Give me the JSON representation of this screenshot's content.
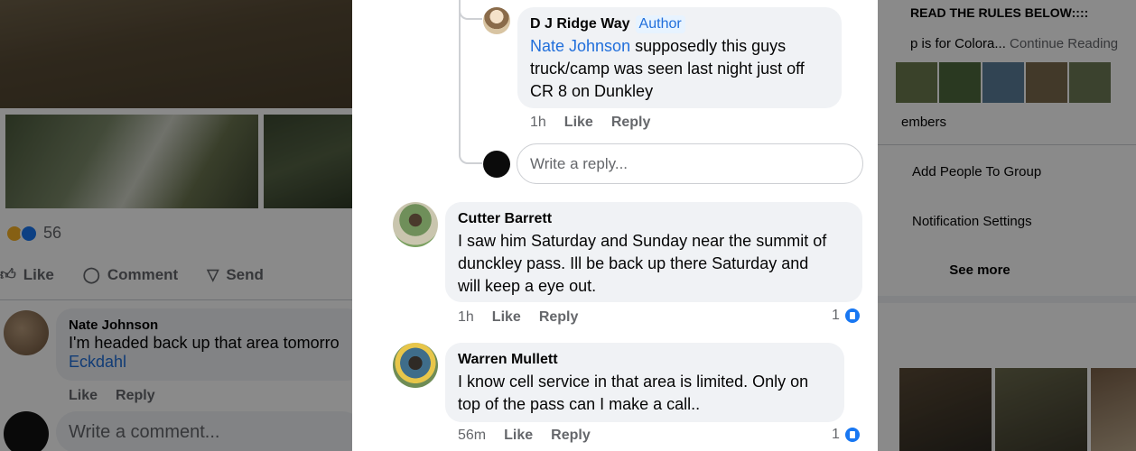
{
  "background_left": {
    "reaction_count": "56",
    "actions": {
      "like": "Like",
      "comment": "Comment",
      "send": "Send"
    },
    "comment": {
      "author": "Nate Johnson",
      "text": "I'm headed back up that area tomorro",
      "mention": "Eckdahl",
      "like": "Like",
      "reply": "Reply"
    },
    "composer_placeholder": "Write a comment..."
  },
  "background_right": {
    "rules_heading": "READ THE RULES BELOW::::",
    "about_text": "p is for Colora...",
    "continue": "Continue Reading",
    "members": "embers",
    "menu": [
      "Add People To Group",
      "Notification Settings"
    ],
    "see_more": "See more"
  },
  "thread": {
    "reply": {
      "author": "D J Ridge Way",
      "badge": "Author",
      "mention": "Nate Johnson",
      "text_line1": " supposedly this guys",
      "text_line2": "truck/camp was seen last night just off",
      "text_line3": "CR 8 on Dunkley",
      "time": "1h",
      "like": "Like",
      "reply": "Reply"
    },
    "reply_input_placeholder": "Write a reply...",
    "comments": [
      {
        "author": "Cutter Barrett",
        "lines": [
          "I saw him Saturday and Sunday near the summit of",
          "dunckley pass. Ill be back up there Saturday and",
          "will keep a eye out."
        ],
        "time": "1h",
        "like": "Like",
        "reply": "Reply",
        "likes": "1"
      },
      {
        "author": "Warren Mullett",
        "lines": [
          "I know cell service in that area is limited. Only on",
          "top of the pass can I make a call.."
        ],
        "time": "56m",
        "like": "Like",
        "reply": "Reply",
        "likes": "1"
      }
    ]
  },
  "colors": {
    "link": "#216fdb",
    "bubble": "#f0f2f5",
    "like_blue": "#1877f2",
    "meta_gray": "#65676b"
  }
}
